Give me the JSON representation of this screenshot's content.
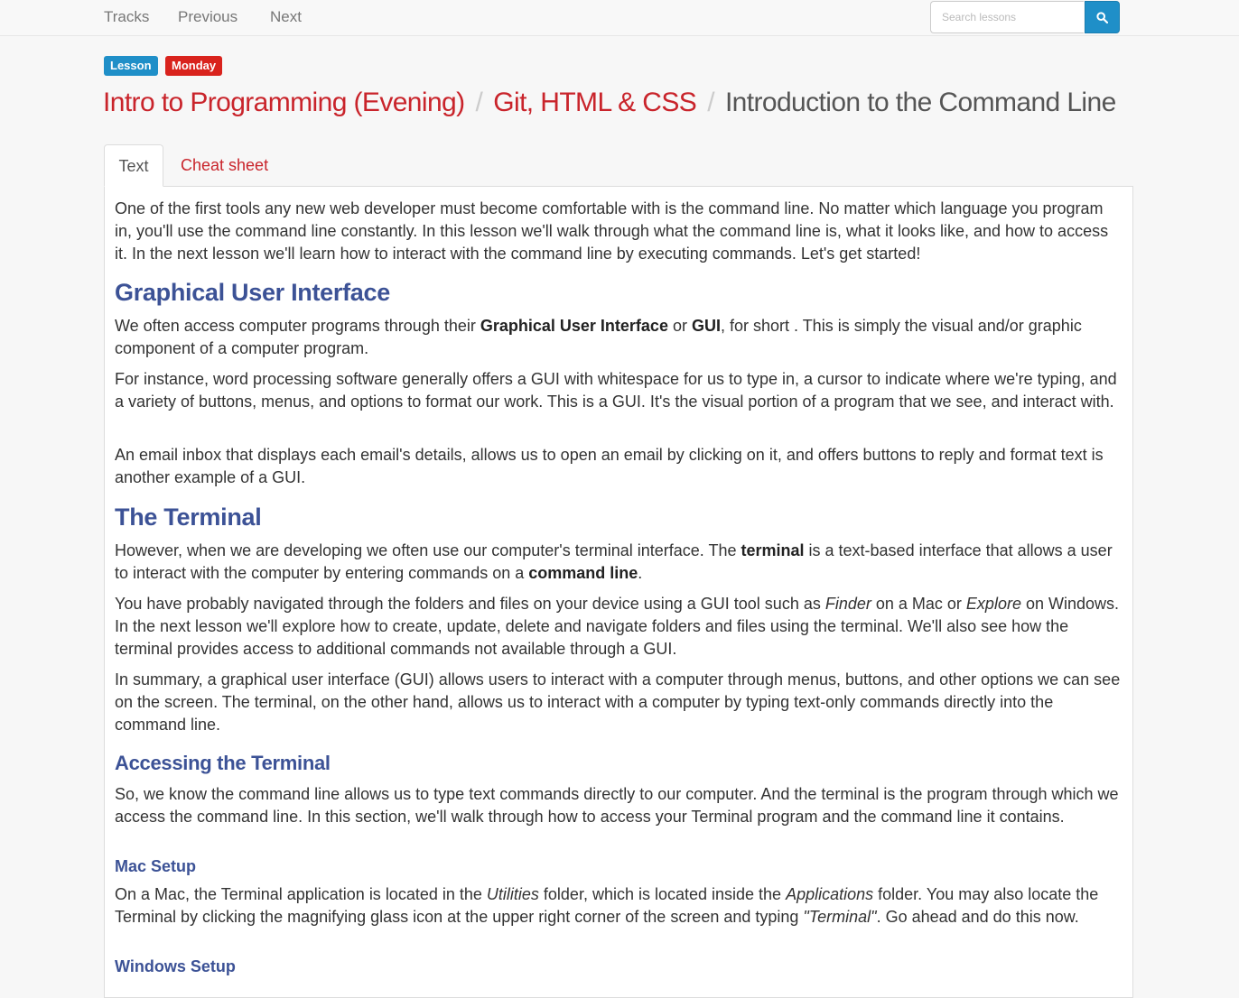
{
  "nav": {
    "tracks": "Tracks",
    "previous": "Previous",
    "next": "Next",
    "search_placeholder": "Search lessons"
  },
  "badges": {
    "type": "Lesson",
    "day": "Monday"
  },
  "breadcrumb": {
    "course": "Intro to Programming (Evening)",
    "section": "Git, HTML & CSS",
    "lesson": "Introduction to the Command Line",
    "separator": "/"
  },
  "tabs": {
    "text": "Text",
    "cheat_sheet": "Cheat sheet"
  },
  "colors": {
    "accent_red": "#c9242b",
    "accent_blue": "#1f8fc8",
    "heading_blue": "#3c5296"
  },
  "article": {
    "intro": "One of the first tools any new web developer must become comfortable with is the command line. No matter which language you program in, you'll use the command line constantly. In this lesson we'll walk through what the command line is, what it looks like, and how to access it. In the next lesson we'll learn how to interact with the command line by executing commands. Let's get started!",
    "h_gui": "Graphical User Interface",
    "gui_p1_a": "We often access computer programs through their ",
    "gui_p1_b": "Graphical User Interface",
    "gui_p1_c": " or ",
    "gui_p1_d": "GUI",
    "gui_p1_e": ", for short . This is simply the visual and/or graphic component of a computer program.",
    "gui_p2": "For instance, word processing software generally offers a GUI with whitespace for us to type in, a cursor to indicate where we're typing, and a variety of buttons, menus, and options to format our work. This is a GUI. It's the visual portion of a program that we see, and interact with.",
    "gui_p3": "An email inbox that displays each email's details, allows us to open an email by clicking on it, and offers buttons to reply and format text is another example of a GUI.",
    "h_terminal": "The Terminal",
    "term_p1_a": "However, when we are developing we often use our computer's terminal interface. The ",
    "term_p1_b": "terminal",
    "term_p1_c": " is a text-based interface that allows a user to interact with the computer by entering commands on a ",
    "term_p1_d": "command line",
    "term_p1_e": ".",
    "term_p2_a": "You have probably navigated through the folders and files on your device using a GUI tool such as ",
    "term_p2_b": "Finder",
    "term_p2_c": " on a Mac or ",
    "term_p2_d": "Explore",
    "term_p2_e": " on Windows. In the next lesson we'll explore how to create, update, delete and navigate folders and files using the terminal. We'll also see how the terminal provides access to additional commands not available through a GUI.",
    "term_p3": "In summary, a graphical user interface (GUI) allows users to interact with a computer through menus, buttons, and other options we can see on the screen. The terminal, on the other hand, allows us to interact with a computer by typing text-only commands directly into the command line.",
    "h_access": "Accessing the Terminal",
    "access_p1": "So, we know the command line allows us to type text commands directly to our computer. And the terminal is the program through which we access the command line. In this section, we'll walk through how to access your Terminal program and the command line it contains.",
    "h_mac": "Mac Setup",
    "mac_p_a": "On a Mac, the Terminal application is located in the ",
    "mac_p_b": "Utilities",
    "mac_p_c": " folder, which is located inside the ",
    "mac_p_d": "Applications",
    "mac_p_e": " folder. You may also locate the Terminal by clicking the magnifying glass icon at the upper right corner of the screen and typing ",
    "mac_p_f": "\"Terminal\"",
    "mac_p_g": ". Go ahead and do this now.",
    "h_windows": "Windows Setup"
  }
}
